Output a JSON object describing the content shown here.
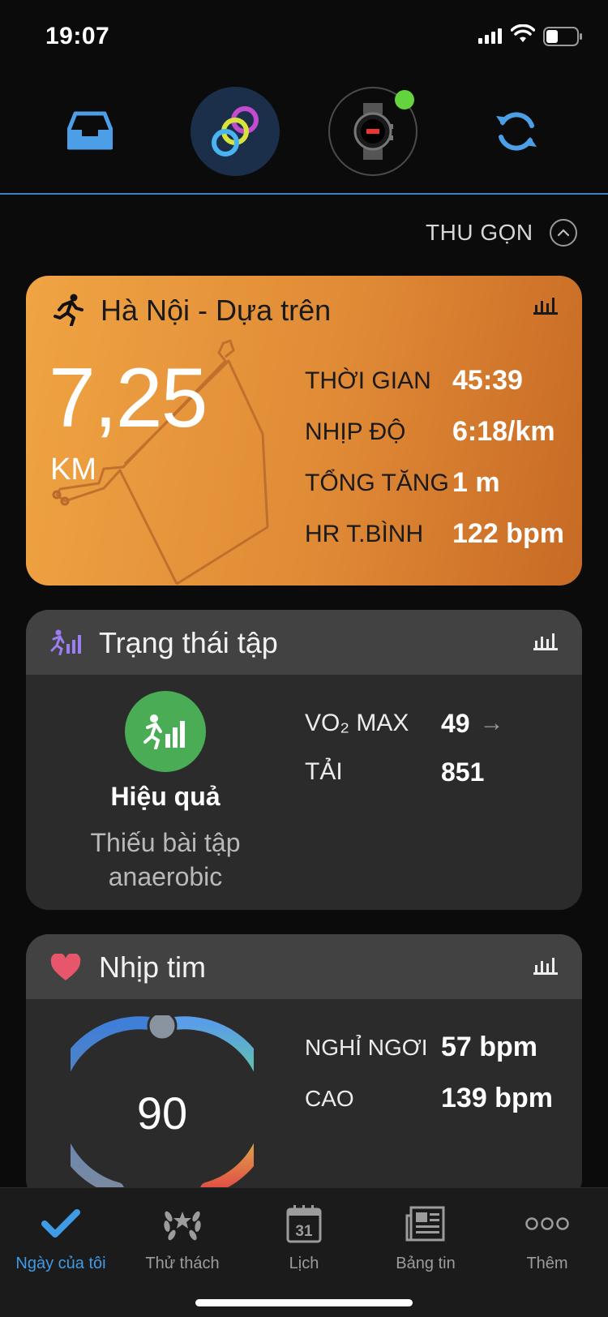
{
  "status_bar": {
    "time": "19:07"
  },
  "toolbar": {
    "items": [
      {
        "icon": "inbox-icon"
      },
      {
        "icon": "activity-rings-icon"
      },
      {
        "icon": "watch-device-icon"
      },
      {
        "icon": "sync-icon"
      }
    ]
  },
  "collapse": {
    "label": "THU GỌN"
  },
  "activity": {
    "title": "Hà Nội - Dựa trên",
    "distance": "7,25",
    "unit": "KM",
    "stats": [
      {
        "label": "THỜI GIAN",
        "value": "45:39"
      },
      {
        "label": "NHỊP ĐỘ",
        "value": "6:18/km"
      },
      {
        "label": "TỔNG TĂNG",
        "value": "1 m"
      },
      {
        "label": "HR T.BÌNH",
        "value": "122 bpm"
      }
    ]
  },
  "training_status": {
    "title": "Trạng thái tập",
    "state": "Hiệu quả",
    "description": "Thiếu bài tập anaerobic",
    "metrics": [
      {
        "label": "VO₂ MAX",
        "value": "49"
      },
      {
        "label": "TẢI",
        "value": "851"
      }
    ]
  },
  "heart_rate": {
    "title": "Nhịp tim",
    "current": "90",
    "metrics": [
      {
        "label": "NGHỈ NGƠI",
        "value": "57 bpm"
      },
      {
        "label": "CAO",
        "value": "139 bpm"
      }
    ]
  },
  "bottom_nav": {
    "items": [
      {
        "label": "Ngày của tôi",
        "icon": "checkmark-icon",
        "active": true
      },
      {
        "label": "Thử thách",
        "icon": "laurel-icon"
      },
      {
        "label": "Lịch",
        "icon": "calendar-icon",
        "day": "31"
      },
      {
        "label": "Bảng tin",
        "icon": "newsfeed-icon"
      },
      {
        "label": "Thêm",
        "icon": "more-icon"
      }
    ]
  },
  "colors": {
    "accent": "#3f9be6",
    "activity_card": "#e08a36",
    "status_good": "#4aad55",
    "heart": "#e8566b"
  }
}
